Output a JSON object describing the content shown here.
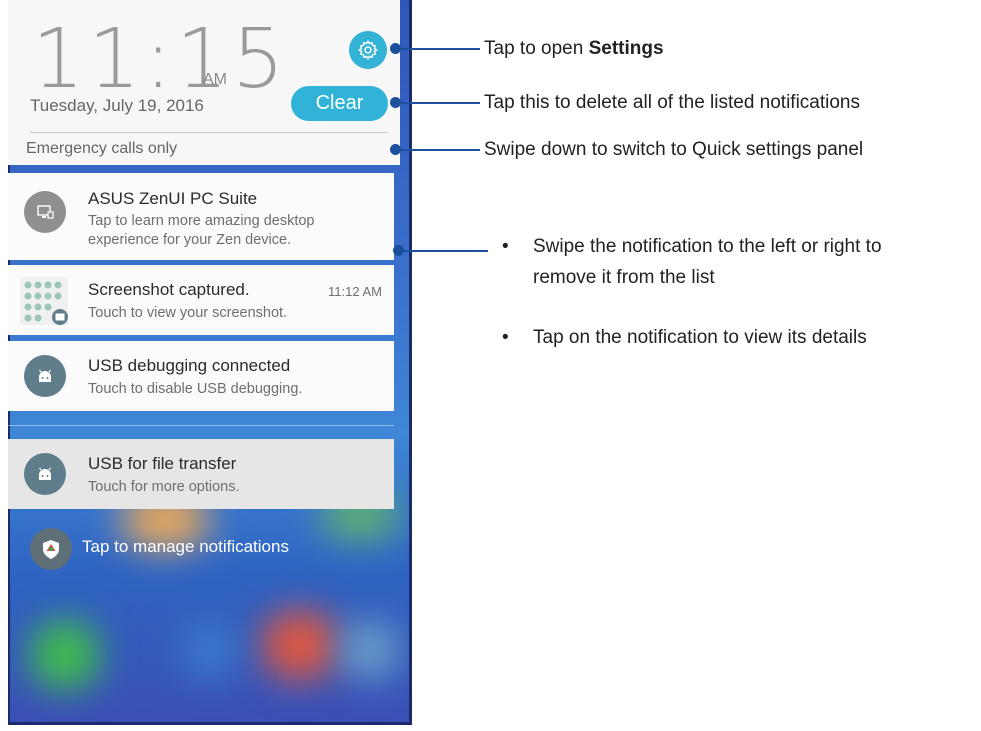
{
  "statusbar": {
    "time": "11:15",
    "ampm": "AM",
    "date": "Tuesday, July 19, 2016",
    "clear_label": "Clear",
    "emergency": "Emergency calls only"
  },
  "notifications": [
    {
      "title": "ASUS ZenUI PC Suite",
      "line1": "Tap to learn more amazing desktop",
      "line2": "experience for your Zen device.",
      "icon": "desktop-icon"
    },
    {
      "title": "Screenshot captured.",
      "line1": "Touch to view your screenshot.",
      "time": "11:12 AM",
      "icon": "screenshot-thumbnail"
    },
    {
      "title": "USB debugging connected",
      "line1": "Touch to disable USB debugging.",
      "icon": "android-icon"
    },
    {
      "title": "USB for file transfer",
      "line1": "Touch for more options.",
      "icon": "android-icon"
    }
  ],
  "manage_label": "Tap to manage notifications",
  "callouts": {
    "settings_prefix": "Tap to open ",
    "settings_bold": "Settings",
    "clear": "Tap this to delete all of the listed notifications",
    "swipe": "Swipe down to switch to Quick settings panel",
    "bullet1_line1": "Swipe the notification to the left or right to",
    "bullet1_line2": "remove it from the list",
    "bullet2": "Tap on the notification to view its details"
  },
  "colors": {
    "accent": "#31b3d7",
    "callout_line": "#1c4f9c",
    "icon_gray": "#5f7d8a"
  }
}
